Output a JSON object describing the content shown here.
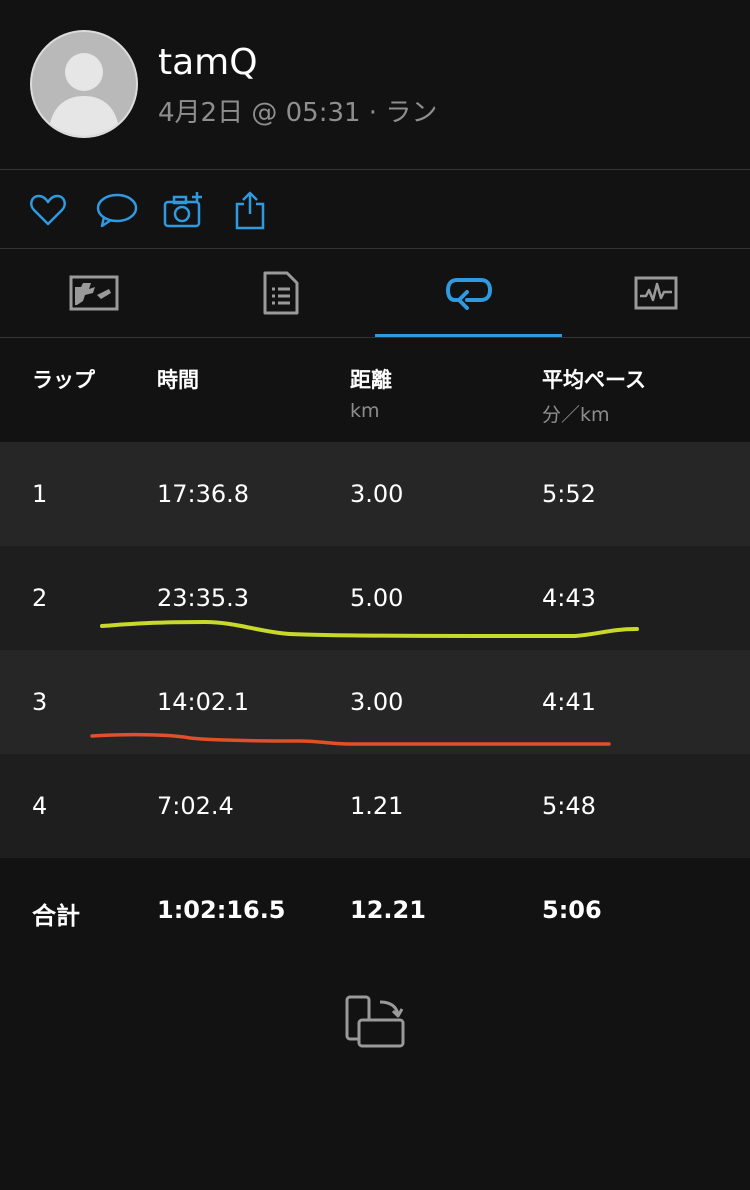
{
  "header": {
    "username": "tamQ",
    "subtitle": "4月2日 @ 05:31 · ラン"
  },
  "actions": [
    "heart-icon",
    "comment-icon",
    "add-photo-icon",
    "share-icon"
  ],
  "tabs": [
    {
      "icon": "map-icon",
      "active": false
    },
    {
      "icon": "details-icon",
      "active": false
    },
    {
      "icon": "laps-icon",
      "active": true
    },
    {
      "icon": "charts-icon",
      "active": false
    }
  ],
  "colors": {
    "accent": "#2f9ae0",
    "highlight_yellow": "#c8d92a",
    "highlight_orange": "#e0502a"
  },
  "table": {
    "headers": {
      "lap": "ラップ",
      "time": "時間",
      "distance": "距離",
      "distance_unit": "km",
      "pace": "平均ペース",
      "pace_unit": "分／km"
    },
    "rows": [
      {
        "lap": "1",
        "time": "17:36.8",
        "distance": "3.00",
        "pace": "5:52"
      },
      {
        "lap": "2",
        "time": "23:35.3",
        "distance": "5.00",
        "pace": "4:43"
      },
      {
        "lap": "3",
        "time": "14:02.1",
        "distance": "3.00",
        "pace": "4:41"
      },
      {
        "lap": "4",
        "time": "7:02.4",
        "distance": "1.21",
        "pace": "5:48"
      }
    ],
    "total": {
      "label": "合計",
      "time": "1:02:16.5",
      "distance": "12.21",
      "pace": "5:06"
    }
  },
  "footer": {
    "icon": "rotate-screen-icon"
  }
}
